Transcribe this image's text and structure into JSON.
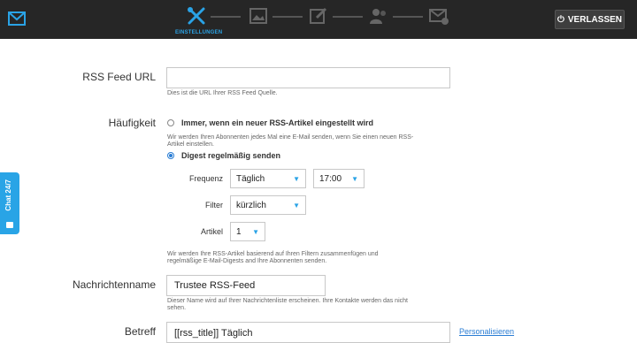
{
  "header": {
    "active_step_label": "EINSTELLUNGEN",
    "exit_label": "VERLASSEN",
    "steps": [
      {
        "icon": "settings-tools-icon",
        "active": true
      },
      {
        "icon": "image-icon",
        "active": false
      },
      {
        "icon": "edit-icon",
        "active": false
      },
      {
        "icon": "contacts-icon",
        "active": false
      },
      {
        "icon": "mail-check-icon",
        "active": false
      }
    ],
    "accent_color": "#2aa3e6"
  },
  "form": {
    "rss_url": {
      "label": "RSS Feed URL",
      "value": "",
      "help": "Dies ist die URL Ihrer RSS Feed Quelle."
    },
    "frequency": {
      "label": "Häufigkeit",
      "option_immediate": "Immer, wenn ein neuer RSS-Artikel eingestellt wird",
      "option_immediate_help_1": "Wir werden Ihren Abonnenten jedes Mal eine E-Mail senden, wenn Sie einen neuen RSS-",
      "option_immediate_help_2": "Artikel einstellen.",
      "option_digest": "Digest regelmäßig senden",
      "selected": "digest"
    },
    "digest": {
      "frequency_label": "Frequenz",
      "frequency_value": "Täglich",
      "time_value": "17:00",
      "filter_label": "Filter",
      "filter_value": "kürzlich",
      "articles_label": "Artikel",
      "articles_value": "1",
      "help_1": "Wir werden Ihre RSS-Artikel basierend auf Ihren Filtern zusammenfügen und",
      "help_2": "regelmäßige E-Mail-Digests and Ihre Abonnenten senden."
    },
    "message_name": {
      "label": "Nachrichtenname",
      "value": "Trustee RSS-Feed",
      "help_1": "Dieser Name wird auf Ihrer Nachrichtenliste erscheinen. Ihre Kontakte werden das nicht",
      "help_2": "sehen."
    },
    "subject": {
      "label": "Betreff",
      "value": "[[rss_title]] Täglich",
      "personalize_label": "Personalisieren"
    }
  },
  "chat": {
    "label": "Chat 24/7"
  }
}
